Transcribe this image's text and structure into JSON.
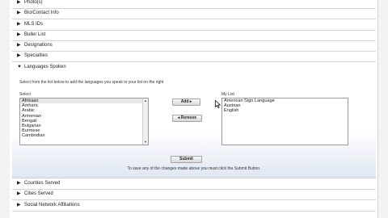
{
  "sections_top": [
    {
      "label": "Photo(s)",
      "arrow": "▶"
    },
    {
      "label": "Bio/Contact Info",
      "arrow": "▶"
    },
    {
      "label": "MLS IDs",
      "arrow": "▶"
    },
    {
      "label": "Buller List",
      "arrow": "▶"
    },
    {
      "label": "Designations",
      "arrow": "▶"
    },
    {
      "label": "Specialties",
      "arrow": "▶"
    }
  ],
  "languages": {
    "header": "Languages Spoken",
    "arrow": "▼",
    "instructions": "Select from the list below to add the languages you speak to your list on the right",
    "select_label": "Select",
    "mylist_label": "My List",
    "available": [
      "Afrikaan",
      "Amharic",
      "Arabic",
      "Armenian",
      "Bengali",
      "Bulgarian",
      "Burmese",
      "Cambodian"
    ],
    "selected_index": 0,
    "my_list": [
      "American Sign Language",
      "Austrian",
      "English"
    ],
    "add_label": "Add ▸",
    "remove_label": "◂ Remove",
    "submit_label": "Submit",
    "note": "To save any of the changes made above you must click the Submit Button."
  },
  "sections_bottom": [
    {
      "label": "Counties Served",
      "arrow": "▶"
    },
    {
      "label": "Cities Served",
      "arrow": "▶"
    },
    {
      "label": "Social Network Affiliations",
      "arrow": "▶"
    }
  ]
}
